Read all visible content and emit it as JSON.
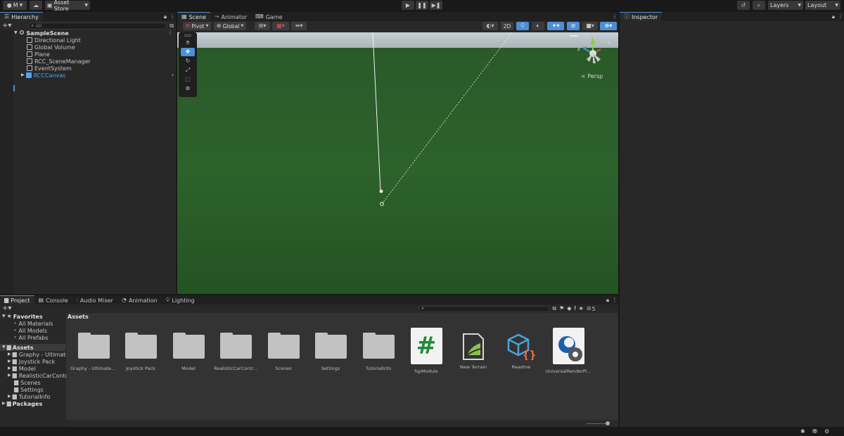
{
  "toolbar": {
    "account_label": "M",
    "asset_store_label": "Asset Store",
    "layers_label": "Layers",
    "layout_label": "Layout"
  },
  "hierarchy": {
    "tab_label": "Hierarchy",
    "search_placeholder": "All",
    "scene_name": "SampleScene",
    "items": [
      {
        "label": "Directional Light"
      },
      {
        "label": "Global Volume"
      },
      {
        "label": "Plane"
      },
      {
        "label": "RCC_SceneManager"
      },
      {
        "label": "EventSystem"
      },
      {
        "label": "RCCCanvas"
      }
    ]
  },
  "scene_view": {
    "tabs": [
      {
        "label": "Scene"
      },
      {
        "label": "Animator"
      },
      {
        "label": "Game"
      }
    ],
    "pivot_label": "Pivot",
    "global_label": "Global",
    "mode_2d_label": "2D",
    "projection_label": "< Persp",
    "gizmo_y": "y",
    "gizmo_z": "z",
    "ground_color": "#2c5e2a",
    "sky_color": "#b5c0c6"
  },
  "inspector": {
    "tab_label": "Inspector"
  },
  "project": {
    "tabs": [
      {
        "label": "Project"
      },
      {
        "label": "Console"
      },
      {
        "label": "Audio Mixer"
      },
      {
        "label": "Animation"
      },
      {
        "label": "Lighting"
      }
    ],
    "hidden_count": "5",
    "favorites_label": "Favorites",
    "favorites": [
      {
        "label": "All Materials"
      },
      {
        "label": "All Models"
      },
      {
        "label": "All Prefabs"
      }
    ],
    "assets_root_label": "Assets",
    "asset_folders": [
      {
        "label": "Graphy - Ultimate"
      },
      {
        "label": "Joystick Pack"
      },
      {
        "label": "Model"
      },
      {
        "label": "RealisticCarContr"
      },
      {
        "label": "Scenes"
      },
      {
        "label": "Settings"
      },
      {
        "label": "TutorialInfo"
      }
    ],
    "packages_label": "Packages",
    "breadcrumb": "Assets",
    "grid_items": [
      {
        "label": "Graphy - Ultimate ...",
        "kind": "folder"
      },
      {
        "label": "Joystick Pack",
        "kind": "folder"
      },
      {
        "label": "Model",
        "kind": "folder"
      },
      {
        "label": "RealisticCarContr...",
        "kind": "folder"
      },
      {
        "label": "Scenes",
        "kind": "folder"
      },
      {
        "label": "Settings",
        "kind": "folder"
      },
      {
        "label": "TutorialInfo",
        "kind": "folder"
      },
      {
        "label": "fspModule",
        "kind": "script"
      },
      {
        "label": "New Terrain",
        "kind": "terrain"
      },
      {
        "label": "Readme",
        "kind": "readme"
      },
      {
        "label": "UniversalRenderPi...",
        "kind": "pipeline"
      }
    ]
  },
  "colors": {
    "accent": "#4d8fd6",
    "selected_item": "#4fa3ff"
  }
}
